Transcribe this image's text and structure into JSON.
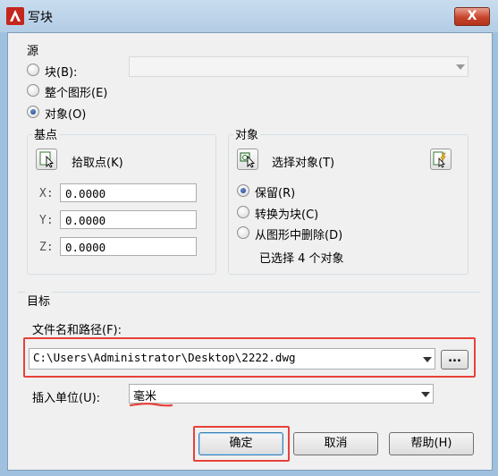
{
  "window": {
    "title": "写块",
    "close_glyph": "X"
  },
  "source": {
    "group_label": "源",
    "opt_block": "块(B):",
    "opt_entire": "整个图形(E)",
    "opt_objects": "对象(O)",
    "block_dropdown_value": ""
  },
  "base_point": {
    "group_label": "基点",
    "pick_label": "拾取点(K)",
    "x_label": "X:",
    "x_value": "0.0000",
    "y_label": "Y:",
    "y_value": "0.0000",
    "z_label": "Z:",
    "z_value": "0.0000"
  },
  "objects": {
    "group_label": "对象",
    "select_label": "选择对象(T)",
    "opt_retain": "保留(R)",
    "opt_convert": "转换为块(C)",
    "opt_delete": "从图形中删除(D)",
    "selected_text": "已选择 4 个对象"
  },
  "destination": {
    "group_label": "目标",
    "path_label": "文件名和路径(F):",
    "path_value": "C:\\Users\\Administrator\\Desktop\\2222.dwg",
    "browse_label": "...",
    "units_label": "插入单位(U):",
    "units_value": "毫米"
  },
  "buttons": {
    "ok": "确定",
    "cancel": "取消",
    "help": "帮助(H)"
  },
  "colors": {
    "highlight_red": "#e8413a",
    "title_gradient": "#b3cde6",
    "close_red": "#c7452c"
  }
}
